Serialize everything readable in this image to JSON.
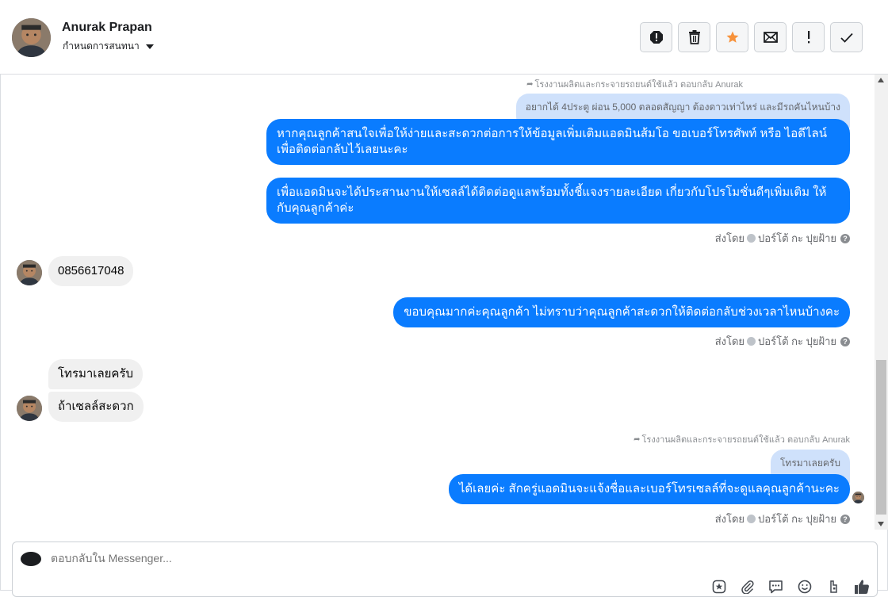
{
  "header": {
    "contact_name": "Anurak Prapan",
    "conversation_label": "กำหนดการสนทนา"
  },
  "toolbar": {
    "buttons": [
      "spam-icon",
      "trash-icon",
      "star-icon",
      "envelope-icon",
      "exclamation-icon",
      "check-icon"
    ],
    "star_color": "#f7923b"
  },
  "messages": {
    "reply_note_1": "โรงงานผลิตและกระจายรถยนต์ใช้แล้ว ตอบกลับ Anurak",
    "quoted_1": "อยากได้ 4ประตู ผ่อน 5,000 ตลอดสัญญา ต้องดาวเท่าไหร่ และมีรถคันไหนบ้าง",
    "out_1": "หากคุณลูกค้าสนใจเพื่อให้ง่ายและสะดวกต่อการให้ข้อมูลเพิ่มเติมแอดมินส้มโอ ขอเบอร์โทรศัพท์ หรือ ไอดีไลน์ เพื่อติดต่อกลับไว้เลยนะคะ",
    "out_2": "เพื่อแอดมินจะได้ประสานงานให้เซลล์ได้ติดต่อดูแลพร้อมทั้งชี้แจงรายละเอียด เกี่ยวกับโปรโมชั่นดีๆเพิ่มเติม ให้กับคุณลูกค้าค่ะ",
    "sent_by_1": "ส่งโดย",
    "sender_1": "ปอร์โต้ กะ ปุยฝ้าย",
    "in_1": "0856617048",
    "out_3": "ขอบคุณมากค่ะคุณลูกค้า ไม่ทราบว่าคุณลูกค้าสะดวกให้ติดต่อกลับช่วงเวลาไหนบ้างคะ",
    "sent_by_2": "ส่งโดย",
    "sender_2": "ปอร์โต้ กะ ปุยฝ้าย",
    "in_2": "โทรมาเลยครับ",
    "in_3": "ถ้าเซลล์สะดวก",
    "reply_note_2": "โรงงานผลิตและกระจายรถยนต์ใช้แล้ว ตอบกลับ Anurak",
    "quoted_2": "โทรมาเลยครับ",
    "out_4": "ได้เลยค่ะ สักครู่แอดมินจะแจ้งชื่อและเบอร์โทรเซลล์ที่จะดูแลคุณลูกค้านะคะ",
    "sent_by_3": "ส่งโดย",
    "sender_3": "ปอร์โต้ กะ ปุยฝ้าย"
  },
  "composer": {
    "placeholder": "ตอบกลับใน Messenger...",
    "icons": [
      "sticker-icon",
      "attachment-icon",
      "saved-replies-icon",
      "emoji-icon",
      "appointment-icon",
      "like-icon"
    ]
  },
  "colors": {
    "outgoing_bubble": "#0a7cff",
    "incoming_bubble": "#f0f0f0",
    "quoted_bubble": "#cfe1fb"
  }
}
